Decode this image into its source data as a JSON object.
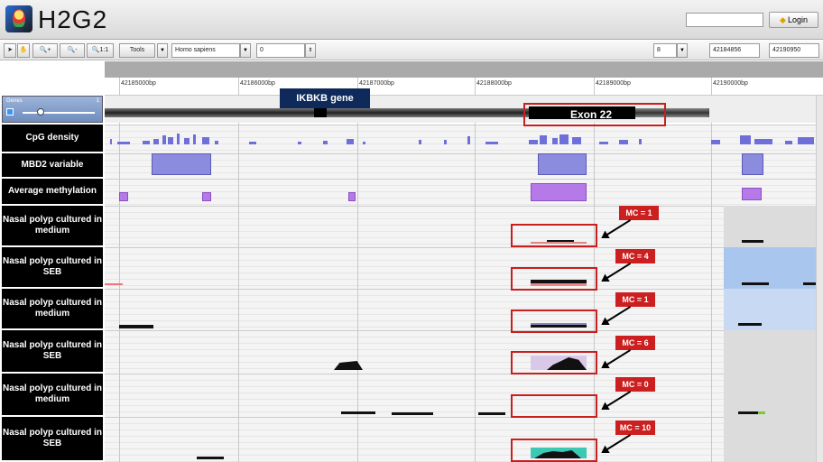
{
  "app": {
    "title": "H2G2"
  },
  "login": {
    "input_value": "",
    "button_label": "Login"
  },
  "toolbar": {
    "zoom_in": "+",
    "zoom_out": "-",
    "zoom_reset": "1:1",
    "tools_label": "Tools",
    "species_value": "Homo sapiens",
    "field_value": "0",
    "chrom_value": "8",
    "start_value": "42184856",
    "end_value": "42190950"
  },
  "ruler": {
    "ticks": [
      "42185000bp",
      "42186000bp",
      "42187000bp",
      "42188000bp",
      "42189000bp",
      "42190000bp"
    ]
  },
  "genes_track": {
    "label": "Genes",
    "count": "1"
  },
  "annotations": {
    "gene_label": "IKBKB gene",
    "exon_label": "Exon 22"
  },
  "tracks": [
    {
      "label": "CpG density"
    },
    {
      "label": "MBD2 variable"
    },
    {
      "label": "Average methylation"
    },
    {
      "label": "Nasal polyp cultured in medium"
    },
    {
      "label": "Nasal polyp cultured in SEB"
    },
    {
      "label": "Nasal polyp cultured in medium"
    },
    {
      "label": "Nasal polyp cultured in SEB"
    },
    {
      "label": "Nasal polyp cultured in medium"
    },
    {
      "label": "Nasal polyp cultured in SEB"
    }
  ],
  "mc_badges": [
    "MC = 1",
    "MC = 4",
    "MC = 1",
    "MC = 6",
    "MC = 0",
    "MC = 10"
  ],
  "colors": {
    "highlight_red": "#c81e1e",
    "gene_label_bg": "#0f2a5a",
    "cpg_blue": "#6f6fd9",
    "methylation_purple": "#b57ae8"
  }
}
